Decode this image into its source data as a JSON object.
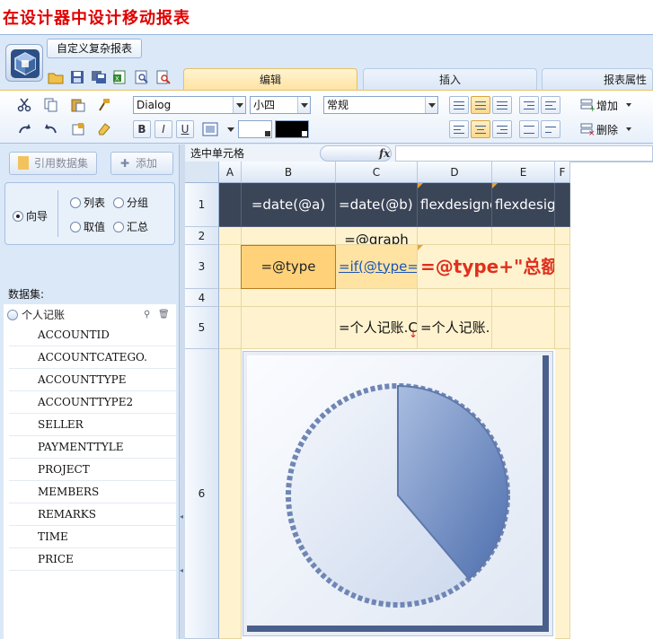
{
  "caption": "在设计器中设计移动报表",
  "report_tab": "自定义复杂报表",
  "tabs": [
    {
      "label": "编辑",
      "active": true
    },
    {
      "label": "插入",
      "active": false
    },
    {
      "label": "报表属性",
      "active": false
    }
  ],
  "toolbar": {
    "font_family": "Dialog",
    "font_size": "小四",
    "number_format": "常规",
    "bold": "B",
    "italic": "I",
    "underline": "U",
    "add_label": "增加",
    "delete_label": "删除"
  },
  "left_panel": {
    "ref_dataset_button": "引用数据集",
    "add_button": "添加",
    "modes": {
      "wizard": "向导",
      "list": "列表",
      "group": "分组",
      "value": "取值",
      "summary": "汇总",
      "selected": "向导"
    },
    "dataset_label": "数据集:",
    "dataset_name": "个人记账",
    "fields": [
      "ACCOUNTID",
      "ACCOUNTCATEGO.",
      "ACCOUNTTYPE",
      "ACCOUNTTYPE2",
      "SELLER",
      "PAYMENTTYLE",
      "PROJECT",
      "MEMBERS",
      "REMARKS",
      "TIME",
      "PRICE"
    ]
  },
  "formula_bar": {
    "name_box": "选中单元格",
    "fx": "fx"
  },
  "sheet": {
    "columns": [
      "A",
      "B",
      "C",
      "D",
      "E",
      "F"
    ],
    "rows": [
      "1",
      "2",
      "3",
      "4",
      "5",
      "6"
    ],
    "cells": {
      "B1": "=date(@a)",
      "C1": "=date(@b)",
      "D1": "flexdesigne",
      "E1": "flexdesig",
      "C2": "=@graph",
      "B3": "=@type",
      "C3": "=if(@type=",
      "D3": "=@type+\"总额",
      "C5": "=个人记账.C",
      "D5": "=个人记账."
    }
  },
  "colors": {
    "title_red": "#e00000",
    "header_dark": "#3b4558",
    "cell_cream": "#fff3cf",
    "active_tab": "#ffe3a3"
  }
}
